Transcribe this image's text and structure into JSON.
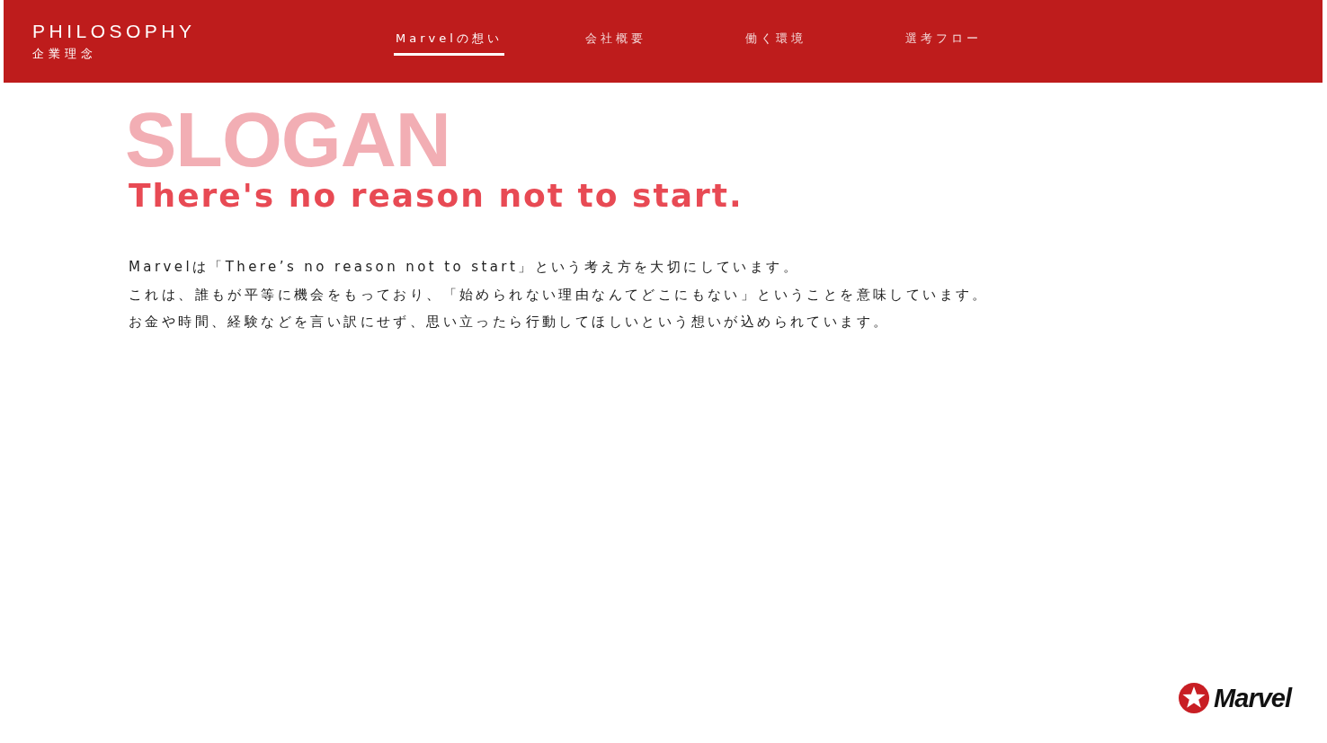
{
  "header": {
    "title": "PHILOSOPHY",
    "subtitle": "企業理念"
  },
  "nav": [
    {
      "label": "Marvelの想い",
      "selected": true
    },
    {
      "label": "会社概要",
      "selected": false
    },
    {
      "label": "働く環境",
      "selected": false
    },
    {
      "label": "選考フロー",
      "selected": false
    }
  ],
  "slogan": {
    "background_word": "SLOGAN",
    "headline": "There's no reason not to start."
  },
  "body_lines": [
    "Marvelは「There’s no reason not to start」という考え方を大切にしています。",
    "これは、誰もが平等に機会をもっており、「始められない理由なんてどこにもない」ということを意味しています。",
    "お金や時間、経験などを言い訳にせず、思い立ったら行動してほしいという想いが込められています。"
  ],
  "logo": {
    "text": "Marvel"
  }
}
